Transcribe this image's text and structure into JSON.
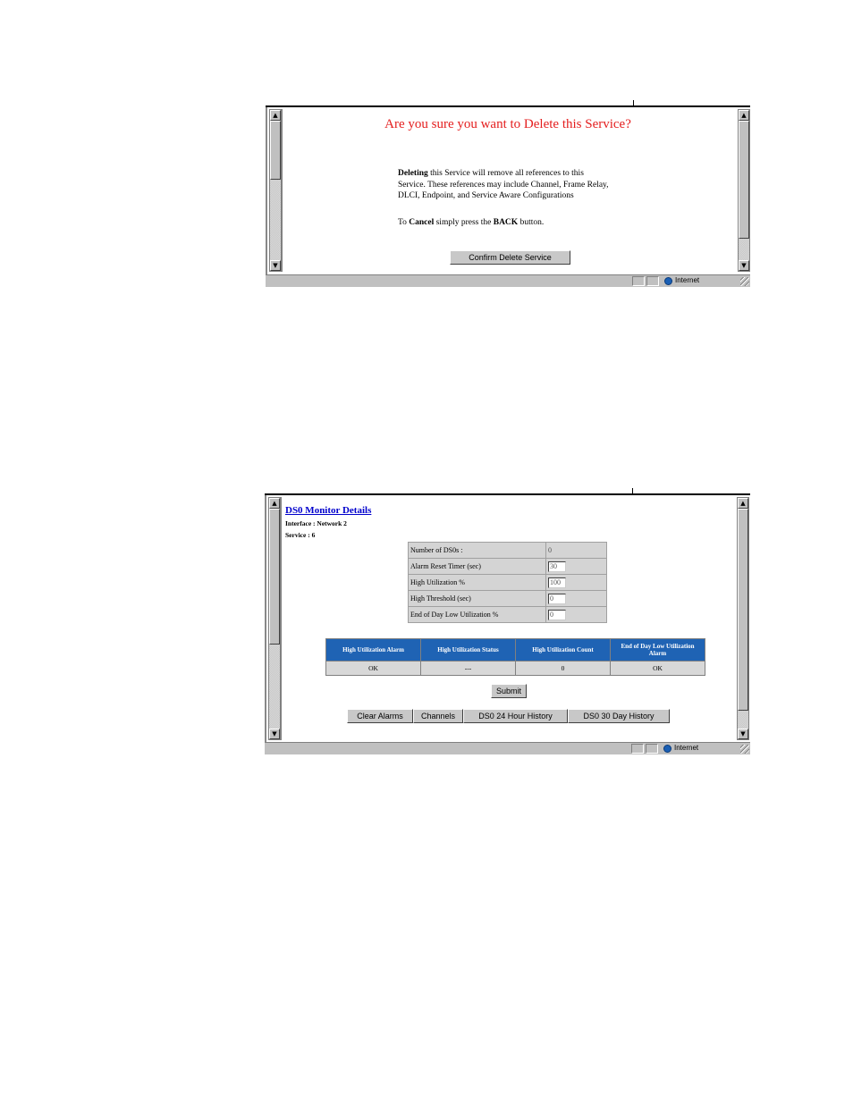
{
  "window1": {
    "heading": "Are you sure you want to Delete this Service?",
    "para1": {
      "bold_lead": "Deleting",
      "line1_rest": " this Service will remove all references to this",
      "line2": "Service. These references may include Channel, Frame Relay,",
      "line3": "DLCI, Endpoint, and  Service Aware Configurations"
    },
    "para2": {
      "prefix": "To ",
      "bold1": "Cancel",
      "middle": " simply press the ",
      "bold2": "BACK",
      "suffix": " button."
    },
    "confirm_button": "Confirm Delete Service",
    "status_zone": "Internet"
  },
  "window2": {
    "title": "DS0 Monitor Details",
    "interface_line": "Interface : Network 2",
    "service_line": "Service : 6",
    "fields": [
      {
        "label": "Number of DS0s :",
        "value": "0"
      },
      {
        "label": "Alarm Reset Timer (sec)",
        "value": "30"
      },
      {
        "label": "High Utilization %",
        "value": "100"
      },
      {
        "label": "High Threshold (sec)",
        "value": "0"
      },
      {
        "label": "End of Day Low Utilization %",
        "value": "0"
      }
    ],
    "alarm_headers": [
      "High Utilization Alarm",
      "High Utilization Status",
      "High Utilization Count",
      "End of Day Low Utilization Alarm"
    ],
    "alarm_values": [
      "OK",
      "---",
      "0",
      "OK"
    ],
    "submit_button": "Submit",
    "bottom_buttons": [
      "Clear Alarms",
      "Channels",
      "DS0 24 Hour History",
      "DS0 30 Day History"
    ],
    "status_zone": "Internet"
  },
  "icons": {
    "scroll_up": "scroll-up-arrow-icon",
    "scroll_down": "scroll-down-arrow-icon",
    "zone": "globe-icon",
    "resize": "resize-grip-icon"
  }
}
